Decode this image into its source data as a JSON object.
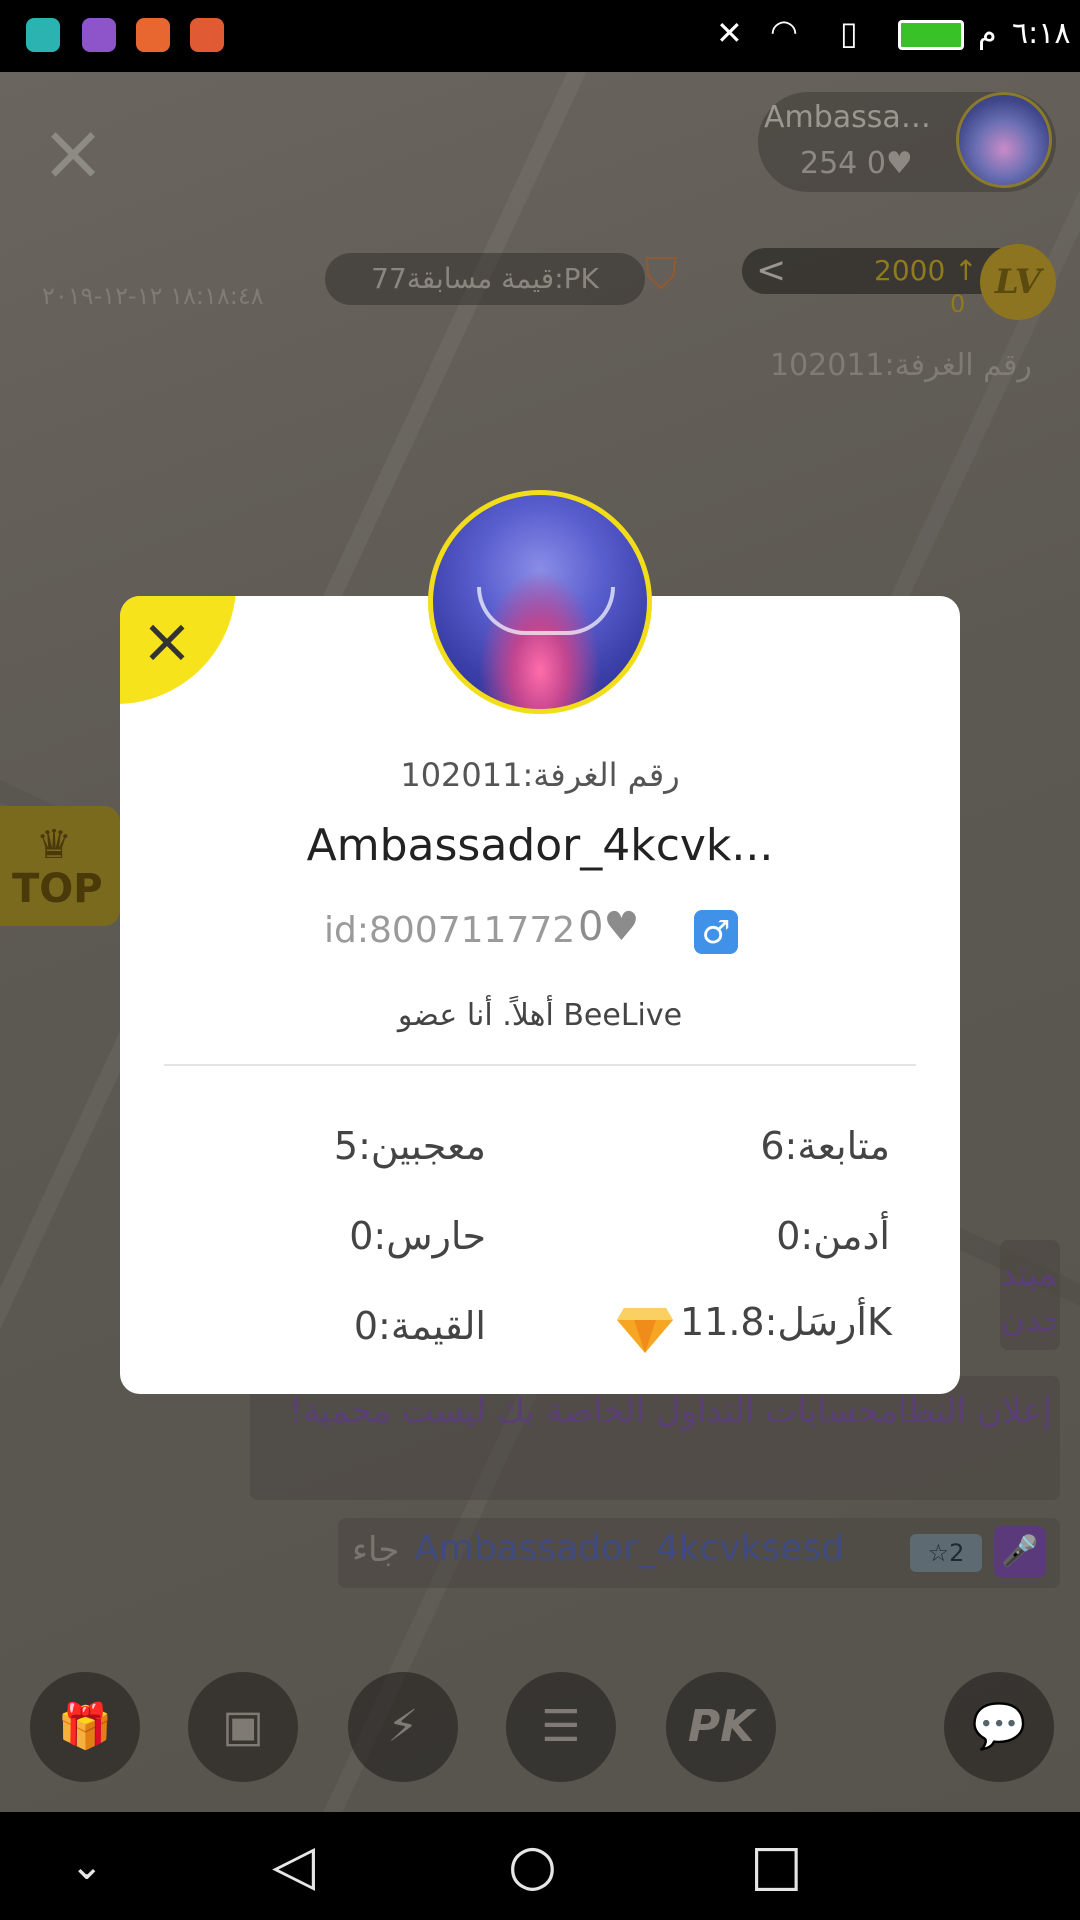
{
  "status_bar": {
    "time": "٦:١٨",
    "ampm": "م",
    "app_icons": [
      "android-icon",
      "gallery-icon",
      "music-icon",
      "music-icon"
    ]
  },
  "room": {
    "host_name": "Ambassad...",
    "host_score": "254",
    "host_hearts": "0",
    "pk_value": "قيمة مسابقة77:PK",
    "date": "١٨:١٨:٤٨ ١٢-١٢-٢٠١٩",
    "lv_count": "2000",
    "lv_sub": "0",
    "lv_label": "LV",
    "room_number": "رقم الغرفة:102011",
    "top_label": "TOP",
    "chat": {
      "system_partial_1": "المبتد",
      "system_partial_2": "وجدن",
      "system_notice": "إعلان النظامحسابات التداول الخاصة بك ليست محمية!",
      "join_name": "Ambassador_4kcvksesd",
      "join_suffix": "جاء",
      "join_level": "2"
    },
    "bottom_buttons": [
      "gift-icon",
      "treasure-chest-icon",
      "flash-camera-icon",
      "message-icon",
      "pk-icon",
      "chat-bubble-icon"
    ]
  },
  "profile": {
    "room_number": "رقم الغرفة:102011",
    "name": "Ambassador_4kcvk...",
    "id": "id:800711772",
    "hearts": "0",
    "gender": "♂",
    "bio": "أهلاً. أنا عضو BeeLive",
    "stats": {
      "following": "متابعة:6",
      "fans": "معجبين:5",
      "admin": "أدمن:0",
      "guard": "حارس:0",
      "sent": "أرسَل:11.8K",
      "value": "القيمة:0"
    },
    "accent_color": "#f6e31b"
  }
}
